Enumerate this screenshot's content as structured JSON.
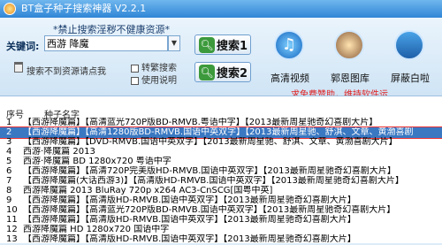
{
  "window": {
    "title": "BT盒子种子搜索神器 V2.2.1"
  },
  "search": {
    "warning": "*禁止搜索淫秽不健康资源*",
    "keyword_label": "关键词:",
    "keyword_value": "西游 降魔",
    "btn1_label": "搜索1",
    "btn2_label": "搜索2",
    "not_found_label": "搜索不到资源请点我",
    "convert_label": "转繁搜索",
    "usage_label": "使用说明"
  },
  "tools": [
    {
      "label": "高清视频",
      "icon": "music-note-icon"
    },
    {
      "label": "郭恩图库",
      "icon": "user-icon"
    },
    {
      "label": "屏蔽白啦",
      "icon": "tool-icon"
    }
  ],
  "promo": "求免费赞助，维持软件运",
  "list": {
    "col_num": "序号",
    "col_name": "种子名字",
    "rows": [
      {
        "num": "1",
        "name": "【西游降魔篇】【高清蓝光720P版BD-RMVB.粤语中字】【2013最新周星驰奇幻喜剧大片】"
      },
      {
        "num": "2",
        "name": "【西游降魔篇】【高清1280版BD-RMVB.国语中英双字】【2013最新周星驰、舒淇、文章、黄渤喜剧",
        "selected": true
      },
      {
        "num": "3",
        "name": "【西游降魔篇】【DVD-RMVB.国语中英双字】【2013最新周星驰、舒淇、文章、黄渤喜剧大片】"
      },
      {
        "num": "4",
        "name": "西游·降魔篇 2013"
      },
      {
        "num": "5",
        "name": "西游·降魔篇 BD 1280x720 粤语中字"
      },
      {
        "num": "6",
        "name": "【西游降魔篇】【高清720P完美版HD-RMVB.国语中英双字】【2013最新周星驰奇幻喜剧大片】"
      },
      {
        "num": "7",
        "name": "【西游降魔篇(大话西游3)】【高清版HD-RMVB.国语中英双字】【2013最新周星驰奇幻喜剧大片】"
      },
      {
        "num": "8",
        "name": "西游降魔篇 2013 BluRay 720p x264 AC3-CnSCG[国粤中英]"
      },
      {
        "num": "9",
        "name": "【西游降魔篇】【高清版HD-RMVB.国语中英双字】【2013最新周星驰奇幻喜剧大片】"
      },
      {
        "num": "10",
        "name": "【西游降魔篇】【高清蓝光720P版BD-RMVB.国语中英双字】【2013最新周星驰奇幻喜剧大片】"
      },
      {
        "num": "11",
        "name": "【西游降魔篇】【高清版HD-RMVB.国语中英双字】【2013最新周星驰奇幻喜剧大片】"
      },
      {
        "num": "12",
        "name": "西游降魔篇 HD 1280x720 国语中字"
      },
      {
        "num": "13",
        "name": "【西游降魔篇】【高清版HD-RMVB.国语中英双字】【2013最新周星驰奇幻喜剧大片】"
      }
    ]
  }
}
